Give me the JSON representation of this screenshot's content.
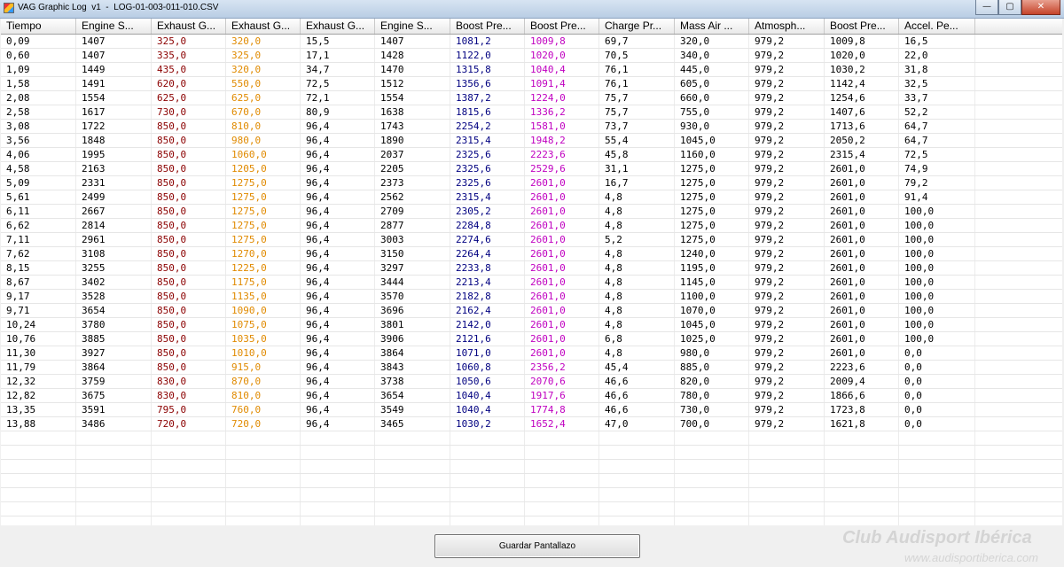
{
  "window": {
    "title": "VAG Graphic Log  v1  -  LOG-01-003-011-010.CSV",
    "minimize_glyph": "—",
    "maximize_glyph": "▢",
    "close_glyph": "✕"
  },
  "colors": {
    "black": "#000000",
    "dark_red": "#8b0000",
    "orange": "#e08a00",
    "navy": "#000080",
    "magenta": "#c000c0"
  },
  "columns": [
    {
      "label": "Tiempo",
      "color": "#000000"
    },
    {
      "label": "Engine S...",
      "color": "#000000"
    },
    {
      "label": "Exhaust G...",
      "color": "#8b0000"
    },
    {
      "label": "Exhaust G...",
      "color": "#e08a00"
    },
    {
      "label": "Exhaust G...",
      "color": "#000000"
    },
    {
      "label": "Engine S...",
      "color": "#000000"
    },
    {
      "label": "Boost Pre...",
      "color": "#000080"
    },
    {
      "label": "Boost Pre...",
      "color": "#c000c0"
    },
    {
      "label": "Charge Pr...",
      "color": "#000000"
    },
    {
      "label": "Mass Air ...",
      "color": "#000000"
    },
    {
      "label": "Atmosph...",
      "color": "#000000"
    },
    {
      "label": "Boost Pre...",
      "color": "#000000"
    },
    {
      "label": "Accel. Pe...",
      "color": "#000000"
    }
  ],
  "rows": [
    [
      "0,09",
      "1407",
      "325,0",
      "320,0",
      "15,5",
      "1407",
      "1081,2",
      "1009,8",
      "69,7",
      "320,0",
      "979,2",
      "1009,8",
      "16,5"
    ],
    [
      "0,60",
      "1407",
      "335,0",
      "325,0",
      "17,1",
      "1428",
      "1122,0",
      "1020,0",
      "70,5",
      "340,0",
      "979,2",
      "1020,0",
      "22,0"
    ],
    [
      "1,09",
      "1449",
      "435,0",
      "320,0",
      "34,7",
      "1470",
      "1315,8",
      "1040,4",
      "76,1",
      "445,0",
      "979,2",
      "1030,2",
      "31,8"
    ],
    [
      "1,58",
      "1491",
      "620,0",
      "550,0",
      "72,5",
      "1512",
      "1356,6",
      "1091,4",
      "76,1",
      "605,0",
      "979,2",
      "1142,4",
      "32,5"
    ],
    [
      "2,08",
      "1554",
      "625,0",
      "625,0",
      "72,1",
      "1554",
      "1387,2",
      "1224,0",
      "75,7",
      "660,0",
      "979,2",
      "1254,6",
      "33,7"
    ],
    [
      "2,58",
      "1617",
      "730,0",
      "670,0",
      "80,9",
      "1638",
      "1815,6",
      "1336,2",
      "75,7",
      "755,0",
      "979,2",
      "1407,6",
      "52,2"
    ],
    [
      "3,08",
      "1722",
      "850,0",
      "810,0",
      "96,4",
      "1743",
      "2254,2",
      "1581,0",
      "73,7",
      "930,0",
      "979,2",
      "1713,6",
      "64,7"
    ],
    [
      "3,56",
      "1848",
      "850,0",
      "980,0",
      "96,4",
      "1890",
      "2315,4",
      "1948,2",
      "55,4",
      "1045,0",
      "979,2",
      "2050,2",
      "64,7"
    ],
    [
      "4,06",
      "1995",
      "850,0",
      "1060,0",
      "96,4",
      "2037",
      "2325,6",
      "2223,6",
      "45,8",
      "1160,0",
      "979,2",
      "2315,4",
      "72,5"
    ],
    [
      "4,58",
      "2163",
      "850,0",
      "1205,0",
      "96,4",
      "2205",
      "2325,6",
      "2529,6",
      "31,1",
      "1275,0",
      "979,2",
      "2601,0",
      "74,9"
    ],
    [
      "5,09",
      "2331",
      "850,0",
      "1275,0",
      "96,4",
      "2373",
      "2325,6",
      "2601,0",
      "16,7",
      "1275,0",
      "979,2",
      "2601,0",
      "79,2"
    ],
    [
      "5,61",
      "2499",
      "850,0",
      "1275,0",
      "96,4",
      "2562",
      "2315,4",
      "2601,0",
      "4,8",
      "1275,0",
      "979,2",
      "2601,0",
      "91,4"
    ],
    [
      "6,11",
      "2667",
      "850,0",
      "1275,0",
      "96,4",
      "2709",
      "2305,2",
      "2601,0",
      "4,8",
      "1275,0",
      "979,2",
      "2601,0",
      "100,0"
    ],
    [
      "6,62",
      "2814",
      "850,0",
      "1275,0",
      "96,4",
      "2877",
      "2284,8",
      "2601,0",
      "4,8",
      "1275,0",
      "979,2",
      "2601,0",
      "100,0"
    ],
    [
      "7,11",
      "2961",
      "850,0",
      "1275,0",
      "96,4",
      "3003",
      "2274,6",
      "2601,0",
      "5,2",
      "1275,0",
      "979,2",
      "2601,0",
      "100,0"
    ],
    [
      "7,62",
      "3108",
      "850,0",
      "1270,0",
      "96,4",
      "3150",
      "2264,4",
      "2601,0",
      "4,8",
      "1240,0",
      "979,2",
      "2601,0",
      "100,0"
    ],
    [
      "8,15",
      "3255",
      "850,0",
      "1225,0",
      "96,4",
      "3297",
      "2233,8",
      "2601,0",
      "4,8",
      "1195,0",
      "979,2",
      "2601,0",
      "100,0"
    ],
    [
      "8,67",
      "3402",
      "850,0",
      "1175,0",
      "96,4",
      "3444",
      "2213,4",
      "2601,0",
      "4,8",
      "1145,0",
      "979,2",
      "2601,0",
      "100,0"
    ],
    [
      "9,17",
      "3528",
      "850,0",
      "1135,0",
      "96,4",
      "3570",
      "2182,8",
      "2601,0",
      "4,8",
      "1100,0",
      "979,2",
      "2601,0",
      "100,0"
    ],
    [
      "9,71",
      "3654",
      "850,0",
      "1090,0",
      "96,4",
      "3696",
      "2162,4",
      "2601,0",
      "4,8",
      "1070,0",
      "979,2",
      "2601,0",
      "100,0"
    ],
    [
      "10,24",
      "3780",
      "850,0",
      "1075,0",
      "96,4",
      "3801",
      "2142,0",
      "2601,0",
      "4,8",
      "1045,0",
      "979,2",
      "2601,0",
      "100,0"
    ],
    [
      "10,76",
      "3885",
      "850,0",
      "1035,0",
      "96,4",
      "3906",
      "2121,6",
      "2601,0",
      "6,8",
      "1025,0",
      "979,2",
      "2601,0",
      "100,0"
    ],
    [
      "11,30",
      "3927",
      "850,0",
      "1010,0",
      "96,4",
      "3864",
      "1071,0",
      "2601,0",
      "4,8",
      "980,0",
      "979,2",
      "2601,0",
      "0,0"
    ],
    [
      "11,79",
      "3864",
      "850,0",
      "915,0",
      "96,4",
      "3843",
      "1060,8",
      "2356,2",
      "45,4",
      "885,0",
      "979,2",
      "2223,6",
      "0,0"
    ],
    [
      "12,32",
      "3759",
      "830,0",
      "870,0",
      "96,4",
      "3738",
      "1050,6",
      "2070,6",
      "46,6",
      "820,0",
      "979,2",
      "2009,4",
      "0,0"
    ],
    [
      "12,82",
      "3675",
      "830,0",
      "810,0",
      "96,4",
      "3654",
      "1040,4",
      "1917,6",
      "46,6",
      "780,0",
      "979,2",
      "1866,6",
      "0,0"
    ],
    [
      "13,35",
      "3591",
      "795,0",
      "760,0",
      "96,4",
      "3549",
      "1040,4",
      "1774,8",
      "46,6",
      "730,0",
      "979,2",
      "1723,8",
      "0,0"
    ],
    [
      "13,88",
      "3486",
      "720,0",
      "720,0",
      "96,4",
      "3465",
      "1030,2",
      "1652,4",
      "47,0",
      "700,0",
      "979,2",
      "1621,8",
      "0,0"
    ]
  ],
  "footer": {
    "save_button_label": "Guardar Pantallazo",
    "watermark": "Club Audisport Ibérica",
    "watermark_url": "www.audisportiberica.com"
  }
}
